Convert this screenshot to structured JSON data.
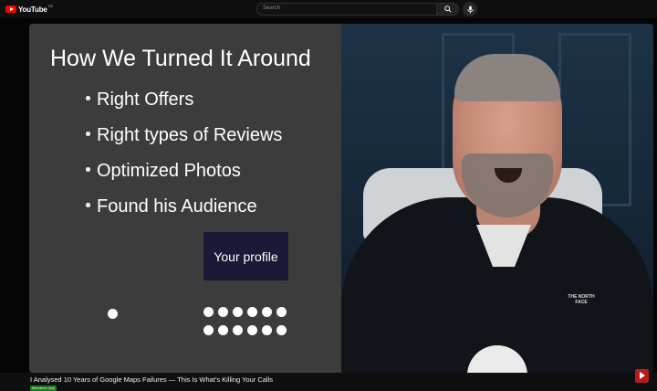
{
  "topbar": {
    "logo_text": "YouTube",
    "logo_country": "DE",
    "search_placeholder": "Search",
    "icons": {
      "search": "search-icon",
      "mic": "mic-icon"
    }
  },
  "slide": {
    "title": "How We Turned It Around",
    "bullets": [
      "Right Offers",
      "Right types of Reviews",
      "Optimized Photos",
      "Found his Audience"
    ],
    "profile_button": "Your profile",
    "background": "#3c3c3c",
    "button_color": "#1a1a38"
  },
  "camera": {
    "jacket_logo": "THE NORTH FACE"
  },
  "video": {
    "title": "I Analysed 10 Years of Google Maps Failures — This Is What's Killing Your Calls",
    "badge": "Members only"
  },
  "colors": {
    "brand_red": "#ff0000",
    "page_bg": "#0f0f0f"
  }
}
